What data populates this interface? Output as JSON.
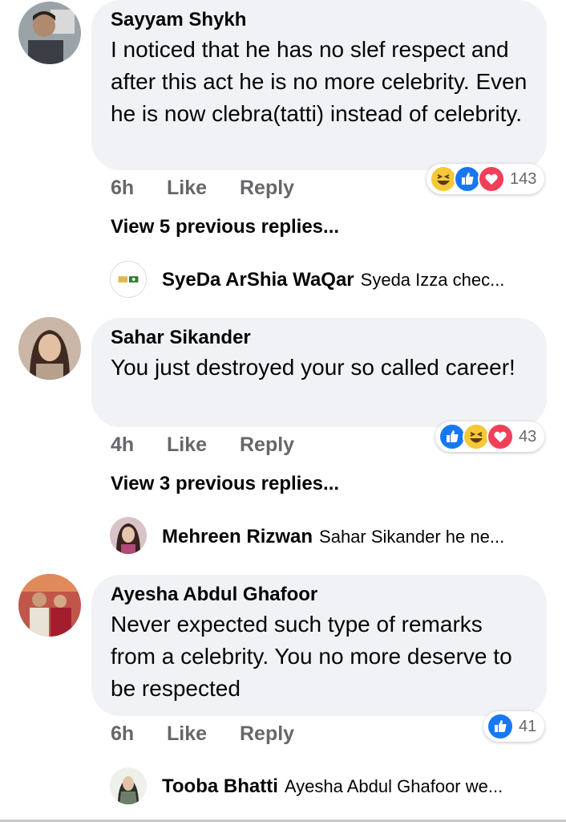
{
  "comments": [
    {
      "author": "Sayyam Shykh",
      "text": "I noticed that he has no slef respect and after this act he is no more celebrity. Even he is now clebra(tatti) instead of celebrity.",
      "time": "6h",
      "like_label": "Like",
      "reply_label": "Reply",
      "reactions": [
        "haha",
        "like",
        "love"
      ],
      "reaction_count": "143",
      "view_previous": "View 5 previous replies...",
      "reply_preview": {
        "name": "SyeDa ArShia WaQar",
        "text": "Syeda Izza chec..."
      }
    },
    {
      "author": "Sahar Sikander",
      "text": "You just destroyed your so called career!",
      "time": "4h",
      "like_label": "Like",
      "reply_label": "Reply",
      "reactions": [
        "like",
        "haha",
        "love"
      ],
      "reaction_count": "43",
      "view_previous": "View 3 previous replies...",
      "reply_preview": {
        "name": "Mehreen Rizwan",
        "text": "Sahar Sikander he ne..."
      }
    },
    {
      "author": "Ayesha Abdul Ghafoor",
      "text": "Never expected such type of remarks from a celebrity. You no more deserve to be respected",
      "time": "6h",
      "like_label": "Like",
      "reply_label": "Reply",
      "reactions": [
        "like"
      ],
      "reaction_count": "41",
      "view_previous": "",
      "reply_preview": {
        "name": "Tooba Bhatti",
        "text": "Ayesha Abdul Ghafoor we..."
      }
    }
  ],
  "colors": {
    "bubble": "#f0f2f5",
    "meta_text": "#65676b",
    "like_blue": "#1877f2",
    "love_red": "#f33e58",
    "haha_yellow": "#f7c836"
  }
}
